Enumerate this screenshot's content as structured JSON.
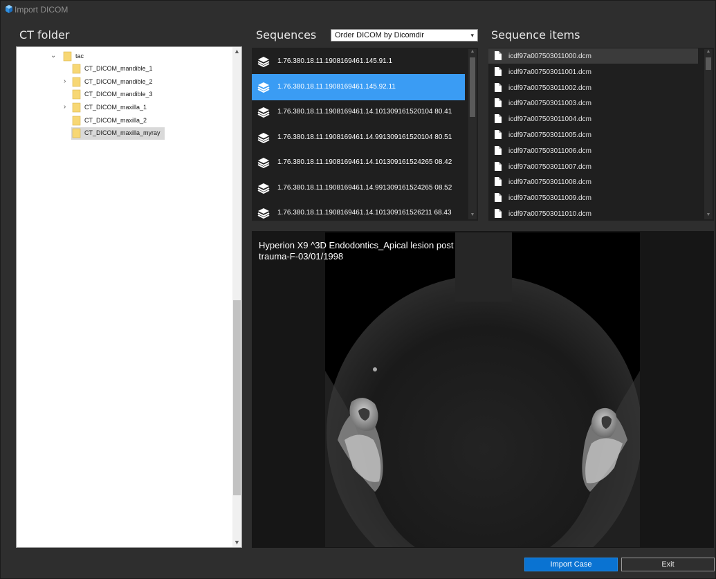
{
  "window": {
    "title": "Import DICOM",
    "icon": "cube-icon"
  },
  "ct_folder": {
    "title": "CT folder",
    "tree": [
      {
        "label": "tac",
        "expander": "expanded"
      },
      {
        "label": "CT_DICOM_mandible_1",
        "expander": "none"
      },
      {
        "label": "CT_DICOM_mandible_2",
        "expander": "collapsed"
      },
      {
        "label": "CT_DICOM_mandible_3",
        "expander": "none"
      },
      {
        "label": "CT_DICOM_maxilla_1",
        "expander": "collapsed"
      },
      {
        "label": "CT_DICOM_maxilla_2",
        "expander": "none"
      },
      {
        "label": "CT_DICOM_maxilla_myray",
        "expander": "none",
        "selected": true
      }
    ]
  },
  "sequences": {
    "title": "Sequences",
    "order_select": {
      "value": "Order DICOM by Dicomdir"
    },
    "items": [
      "1.76.380.18.11.1908169461.145.91.1",
      "1.76.380.18.11.1908169461.145.92.11",
      "1.76.380.18.11.1908169461.14.101309161520104 80.41",
      "1.76.380.18.11.1908169461.14.991309161520104 80.51",
      "1.76.380.18.11.1908169461.14.101309161524265 08.42",
      "1.76.380.18.11.1908169461.14.991309161524265 08.52",
      "1.76.380.18.11.1908169461.14.101309161526211 68.43"
    ],
    "selected_index": 1
  },
  "sequence_items": {
    "title": "Sequence items",
    "files": [
      "icdf97a007503011000.dcm",
      "icdf97a007503011001.dcm",
      "icdf97a007503011002.dcm",
      "icdf97a007503011003.dcm",
      "icdf97a007503011004.dcm",
      "icdf97a007503011005.dcm",
      "icdf97a007503011006.dcm",
      "icdf97a007503011007.dcm",
      "icdf97a007503011008.dcm",
      "icdf97a007503011009.dcm",
      "icdf97a007503011010.dcm"
    ],
    "selected_index": 0
  },
  "viewer": {
    "caption": "Hyperion X9 ^3D Endodontics_Apical lesion post trauma-F-03/01/1998"
  },
  "buttons": {
    "import": "Import Case",
    "exit": "Exit"
  },
  "colors": {
    "accent": "#0a73d2",
    "selection": "#3a9cf4",
    "background": "#2e2e2e"
  }
}
